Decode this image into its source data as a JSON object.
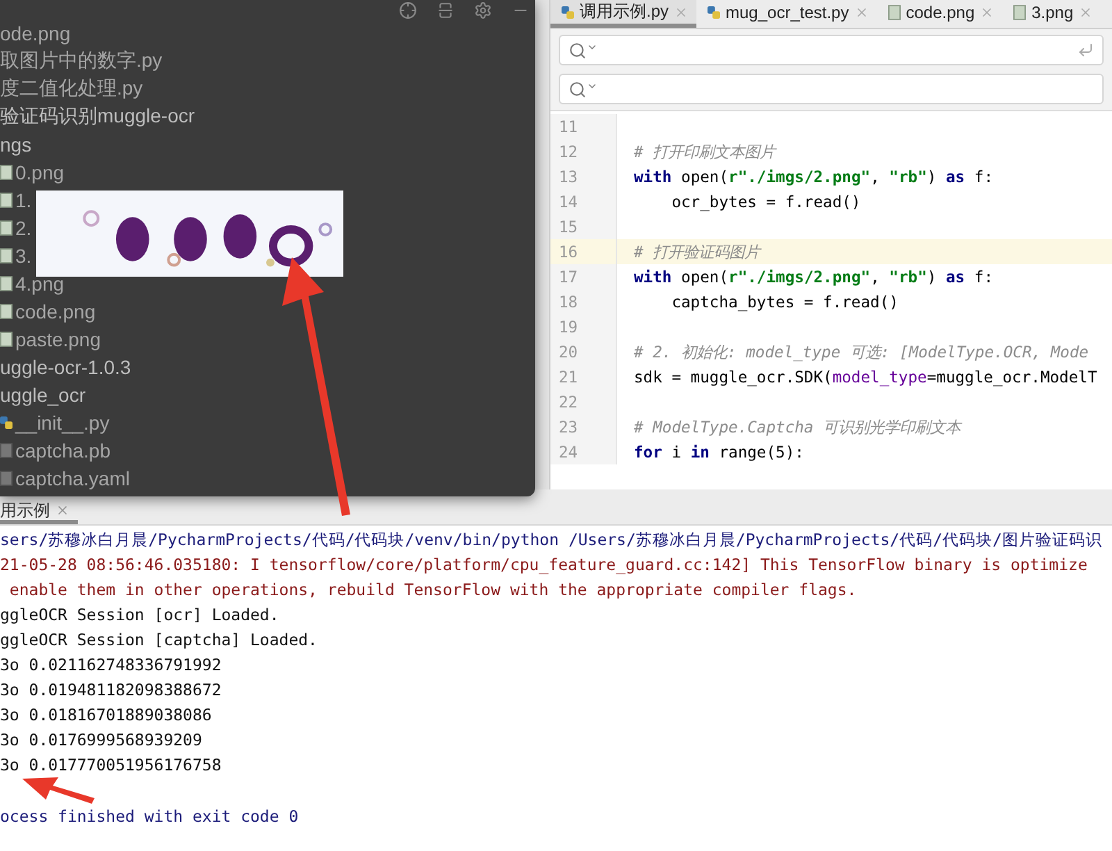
{
  "project_popup": {
    "tree": [
      {
        "label": "ode.png",
        "kind": "image"
      },
      {
        "label": "取图片中的数字.py",
        "kind": "python"
      },
      {
        "label": "度二值化处理.py",
        "kind": "python"
      },
      {
        "label": "验证码识别muggle-ocr",
        "kind": "folder",
        "children": [
          {
            "label": "ngs",
            "kind": "folder",
            "children": [
              {
                "label": "0.png",
                "kind": "image"
              },
              {
                "label": "1.",
                "kind": "image"
              },
              {
                "label": "2.",
                "kind": "image"
              },
              {
                "label": "3.",
                "kind": "image"
              },
              {
                "label": "4.png",
                "kind": "image"
              },
              {
                "label": "code.png",
                "kind": "image"
              },
              {
                "label": "paste.png",
                "kind": "image"
              }
            ]
          },
          {
            "label": "uggle-ocr-1.0.3",
            "kind": "folder",
            "children": [
              {
                "label": "uggle_ocr",
                "kind": "folder",
                "children": [
                  {
                    "label": "__init__.py",
                    "kind": "python"
                  },
                  {
                    "label": "captcha.pb",
                    "kind": "file"
                  },
                  {
                    "label": "captcha.yaml",
                    "kind": "file"
                  }
                ]
              }
            ]
          }
        ]
      }
    ]
  },
  "editor": {
    "tabs": [
      {
        "label": "调用示例.py",
        "kind": "python",
        "selected": true
      },
      {
        "label": "mug_ocr_test.py",
        "kind": "python",
        "selected": false
      },
      {
        "label": "code.png",
        "kind": "image",
        "selected": false
      },
      {
        "label": "3.png",
        "kind": "image",
        "selected": false
      }
    ],
    "lines": [
      {
        "number": "11",
        "current": false
      },
      {
        "number": "12",
        "current": false,
        "tokens": [
          {
            "kind": "comment",
            "text": "# 打开印刷文本图片"
          }
        ]
      },
      {
        "number": "13",
        "current": false,
        "tokens": [
          {
            "kind": "keyword",
            "text": "with"
          },
          {
            "kind": "plain",
            "text": " open("
          },
          {
            "kind": "string",
            "text": "r\"./imgs/2.png\""
          },
          {
            "kind": "plain",
            "text": ", "
          },
          {
            "kind": "string",
            "text": "\"rb\""
          },
          {
            "kind": "plain",
            "text": ") "
          },
          {
            "kind": "keyword",
            "text": "as"
          },
          {
            "kind": "plain",
            "text": " f:"
          }
        ]
      },
      {
        "number": "14",
        "current": false,
        "tokens": [
          {
            "kind": "plain",
            "text": "    ocr_bytes = f.read()"
          }
        ]
      },
      {
        "number": "15",
        "current": false
      },
      {
        "number": "16",
        "current": true,
        "tokens": [
          {
            "kind": "comment",
            "text": "# 打开验证码图片"
          }
        ]
      },
      {
        "number": "17",
        "current": false,
        "tokens": [
          {
            "kind": "keyword",
            "text": "with"
          },
          {
            "kind": "plain",
            "text": " open("
          },
          {
            "kind": "string",
            "text": "r\"./imgs/2.png\""
          },
          {
            "kind": "plain",
            "text": ", "
          },
          {
            "kind": "string",
            "text": "\"rb\""
          },
          {
            "kind": "plain",
            "text": ") "
          },
          {
            "kind": "keyword",
            "text": "as"
          },
          {
            "kind": "plain",
            "text": " f:"
          }
        ]
      },
      {
        "number": "18",
        "current": false,
        "tokens": [
          {
            "kind": "plain",
            "text": "    captcha_bytes = f.read()"
          }
        ]
      },
      {
        "number": "19",
        "current": false
      },
      {
        "number": "20",
        "current": false,
        "tokens": [
          {
            "kind": "comment",
            "text": "# 2. 初始化: model_type 可选: [ModelType.OCR, Mode"
          }
        ]
      },
      {
        "number": "21",
        "current": false,
        "tokens": [
          {
            "kind": "plain",
            "text": "sdk = muggle_ocr.SDK("
          },
          {
            "kind": "param",
            "text": "model_type"
          },
          {
            "kind": "plain",
            "text": "=muggle_ocr.ModelT"
          }
        ]
      },
      {
        "number": "22",
        "current": false
      },
      {
        "number": "23",
        "current": false,
        "tokens": [
          {
            "kind": "comment",
            "text": "# ModelType.Captcha 可识别光学印刷文本"
          }
        ]
      },
      {
        "number": "24",
        "current": false,
        "tokens": [
          {
            "kind": "keyword",
            "text": "for"
          },
          {
            "kind": "plain",
            "text": " i "
          },
          {
            "kind": "keyword",
            "text": "in"
          },
          {
            "kind": "plain",
            "text": " range(5):"
          }
        ]
      }
    ]
  },
  "console": {
    "tab": {
      "label": "用示例",
      "selected": true
    },
    "lines": [
      {
        "kind": "command",
        "text": "sers/苏穆冰白月晨/PycharmProjects/代码/代码块/venv/bin/python /Users/苏穆冰白月晨/PycharmProjects/代码/代码块/图片验证码识"
      },
      {
        "kind": "error",
        "text": "21-05-28 08:56:46.035180: I tensorflow/core/platform/cpu_feature_guard.cc:142] This TensorFlow binary is optimize"
      },
      {
        "kind": "error",
        "text": " enable them in other operations, rebuild TensorFlow with the appropriate compiler flags."
      },
      {
        "kind": "output",
        "text": "ggleOCR Session [ocr] Loaded."
      },
      {
        "kind": "output",
        "text": "ggleOCR Session [captcha] Loaded."
      },
      {
        "kind": "output",
        "text": "3o 0.021162748336791992"
      },
      {
        "kind": "output",
        "text": "3o 0.019481182098388672"
      },
      {
        "kind": "output",
        "text": "3o 0.01816701889038086"
      },
      {
        "kind": "output",
        "text": "3o 0.0176999568939209"
      },
      {
        "kind": "output",
        "text": "3o 0.017770051956176758"
      },
      {
        "kind": "exit",
        "text": "ocess finished with exit code 0"
      }
    ]
  }
}
